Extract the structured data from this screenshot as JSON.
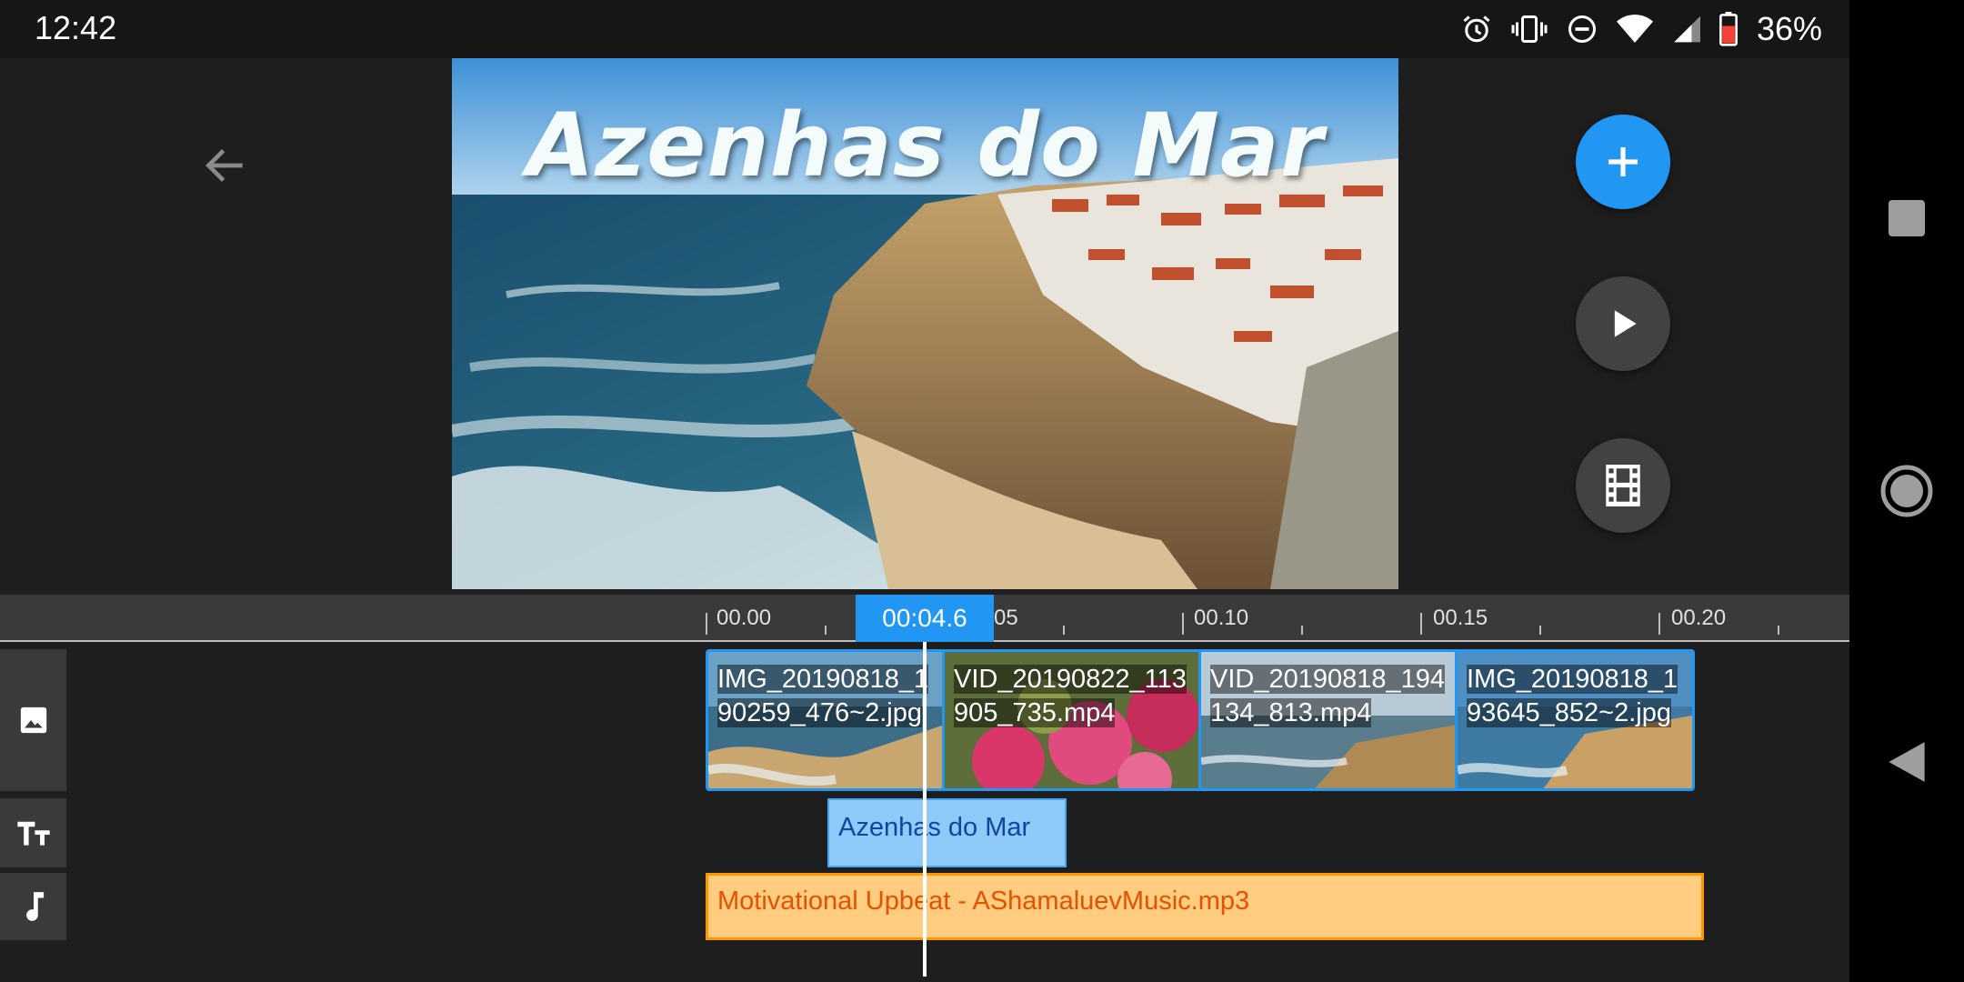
{
  "status_bar": {
    "time": "12:42",
    "battery_percent": "36%",
    "icons": [
      "alarm-icon",
      "vibrate-icon",
      "do-not-disturb-icon",
      "wifi-icon",
      "signal-icon",
      "battery-icon"
    ]
  },
  "editor": {
    "preview_title_text": "Azenhas do Mar",
    "buttons": {
      "back_icon": "arrow-left-icon",
      "add_icon": "plus-icon",
      "play_icon": "play-icon",
      "export_icon": "film-icon"
    },
    "accent_color": "#2196f3"
  },
  "timeline": {
    "current_time": "00:04.6",
    "ruler_labels": [
      "00.00",
      "05",
      "00.10",
      "00.15",
      "00.20"
    ],
    "track_icons": [
      "image-icon",
      "text-icon",
      "music-icon"
    ],
    "video_clips": [
      {
        "label": "IMG_20190818_190259_476~2.jpg"
      },
      {
        "label": "VID_20190822_113905_735.mp4"
      },
      {
        "label": "VID_20190818_194134_813.mp4"
      },
      {
        "label": "IMG_20190818_193645_852~2.jpg"
      }
    ],
    "text_clip": {
      "label": "Azenhas do Mar"
    },
    "audio_clip": {
      "label": "Motivational Upbeat - AShamaluevMusic.mp3"
    }
  },
  "nav_bar": {
    "icons": [
      "recents-icon",
      "home-icon",
      "back-icon"
    ]
  }
}
